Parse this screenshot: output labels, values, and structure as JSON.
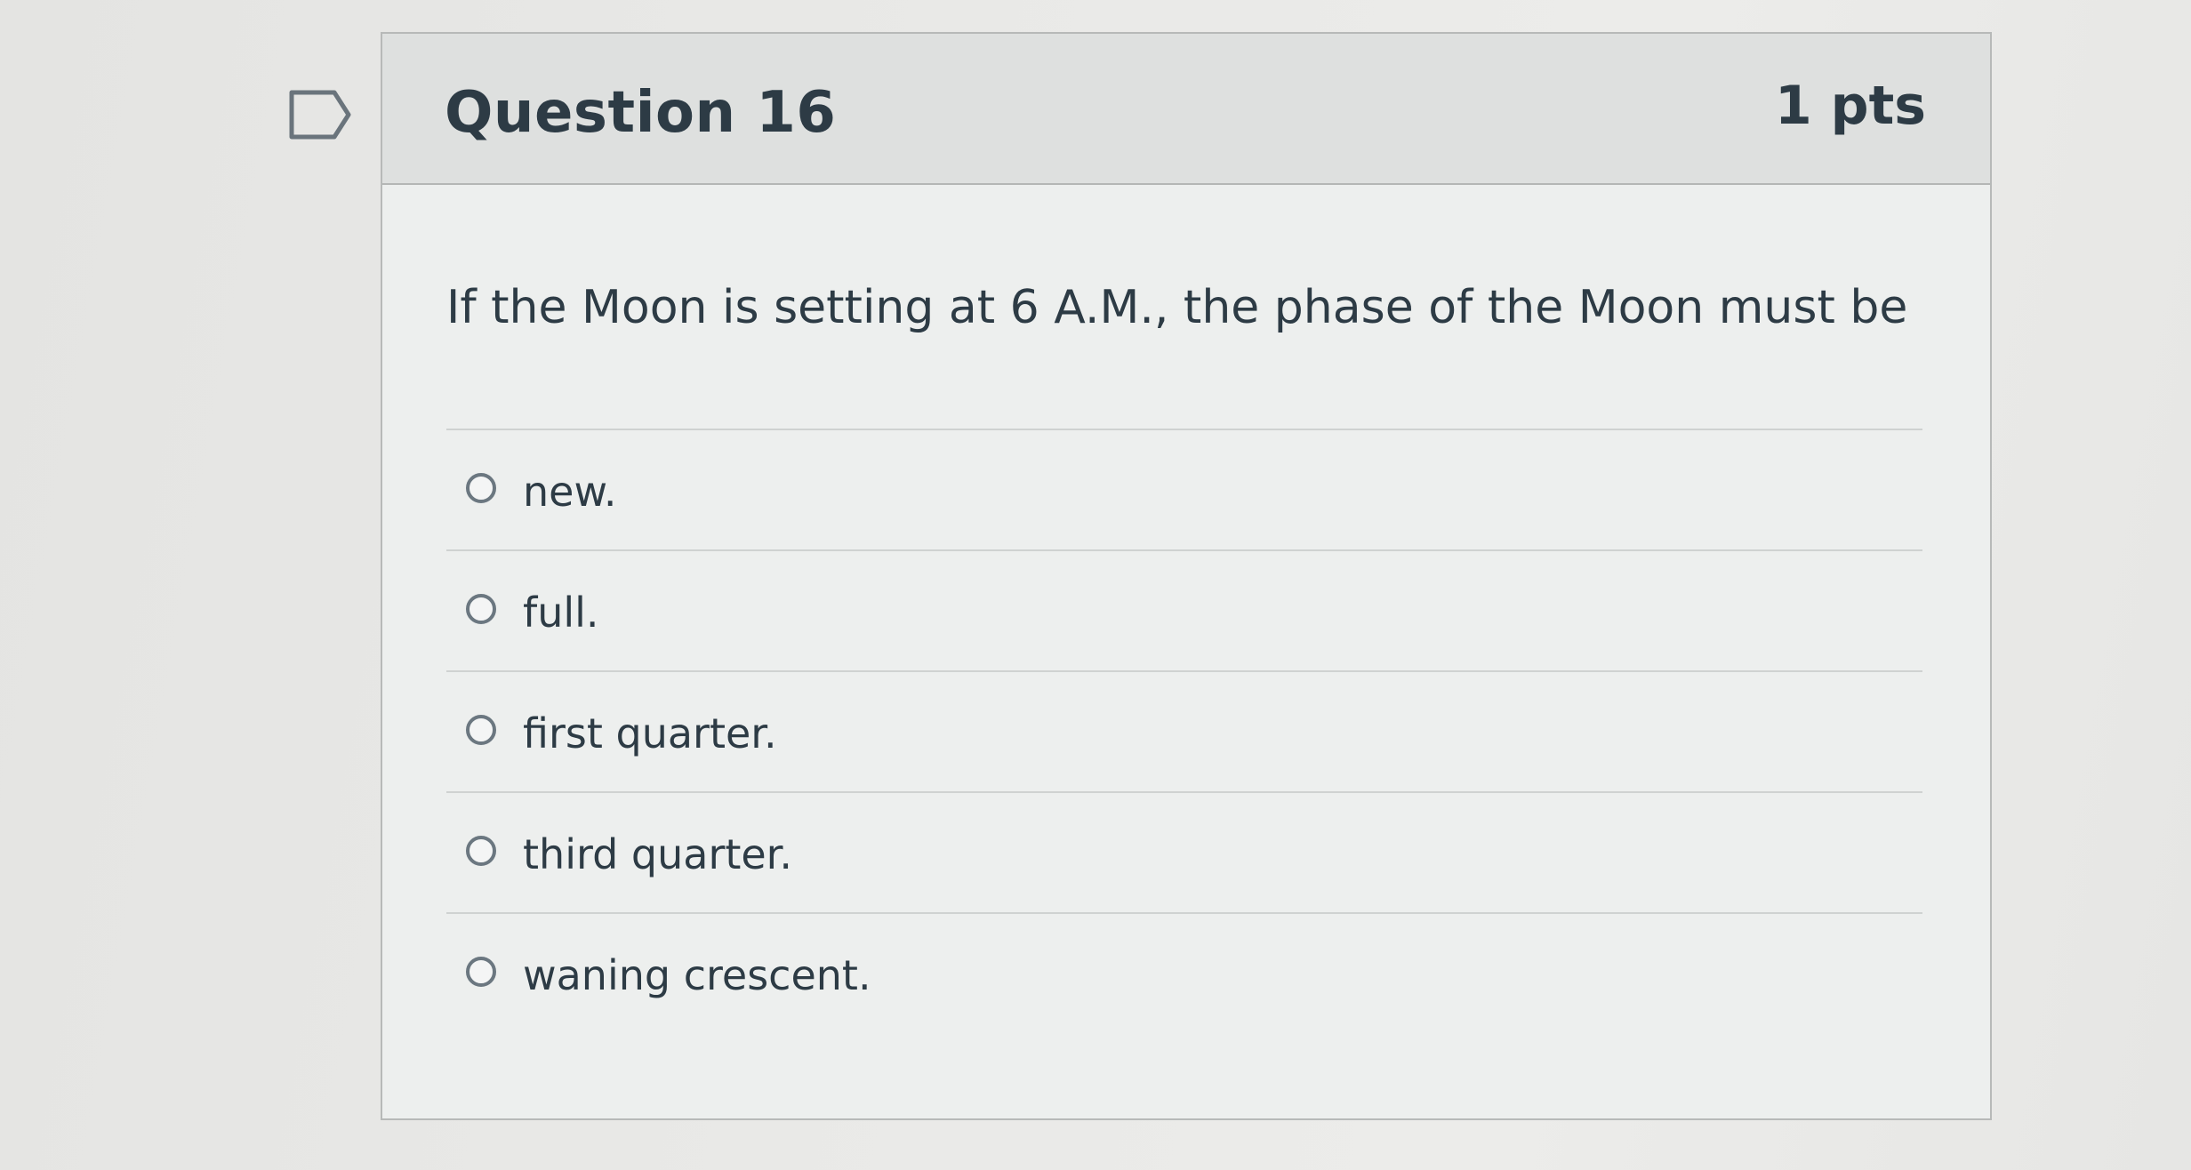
{
  "question": {
    "flag_icon": "flag-outline-icon",
    "title": "Question 16",
    "points": "1 pts",
    "text": "If the Moon is setting at 6 A.M., the phase of the Moon must be",
    "answers": [
      {
        "label": "new."
      },
      {
        "label": "full."
      },
      {
        "label": "first quarter."
      },
      {
        "label": "third quarter."
      },
      {
        "label": "waning crescent."
      }
    ]
  }
}
